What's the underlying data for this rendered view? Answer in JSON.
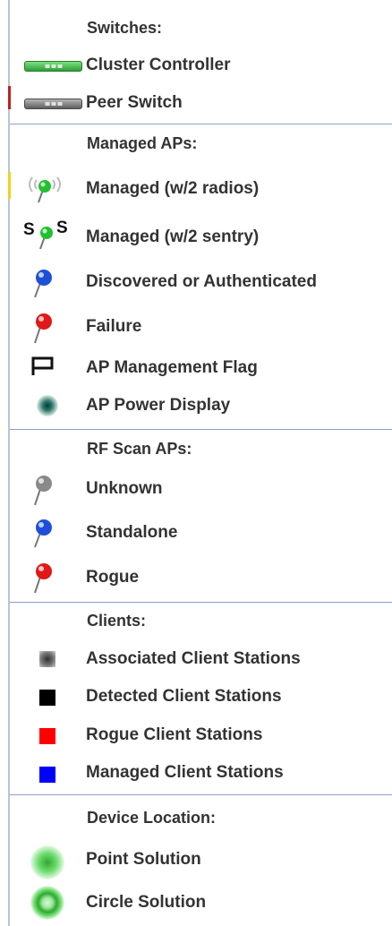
{
  "colors": {
    "divider": "#8aa0c8",
    "text": "#333333",
    "cluster_controller": "#3fb84a",
    "peer_switch": "#777777",
    "pin_green": "#22c030",
    "pin_blue": "#1f4fd8",
    "pin_red": "#e01818",
    "pin_gray": "#8a8a8a",
    "detected_client": "#000000",
    "rogue_client": "#ff0000",
    "managed_client": "#0000ff",
    "location_green": "#5ad05a"
  },
  "sections": {
    "switches": {
      "heading": "Switches:",
      "items": [
        {
          "label": "Cluster Controller",
          "icon": "green-switch-icon"
        },
        {
          "label": "Peer Switch",
          "icon": "gray-switch-icon"
        }
      ]
    },
    "managed_aps": {
      "heading": "Managed APs:",
      "items": [
        {
          "label": "Managed (w/2 radios)",
          "icon": "green-radio-pin-icon"
        },
        {
          "label": "Managed (w/2 sentry)",
          "icon": "green-sentry-pin-icon",
          "sentry_text": "S"
        },
        {
          "label": "Discovered or Authenticated",
          "icon": "blue-pin-icon"
        },
        {
          "label": "Failure",
          "icon": "red-pin-icon"
        },
        {
          "label": "AP Management Flag",
          "icon": "flag-icon"
        },
        {
          "label": "AP Power Display",
          "icon": "power-dot-icon"
        }
      ]
    },
    "rf_scan_aps": {
      "heading": "RF Scan APs:",
      "items": [
        {
          "label": "Unknown",
          "icon": "gray-pin-icon"
        },
        {
          "label": "Standalone",
          "icon": "blue-pin-icon"
        },
        {
          "label": "Rogue",
          "icon": "red-pin-icon"
        }
      ]
    },
    "clients": {
      "heading": "Clients:",
      "items": [
        {
          "label": "Associated Client Stations",
          "icon": "gradient-square-icon"
        },
        {
          "label": "Detected Client Stations",
          "icon": "black-square-icon"
        },
        {
          "label": "Rogue Client Stations",
          "icon": "red-square-icon"
        },
        {
          "label": "Managed Client Stations",
          "icon": "blue-square-icon"
        }
      ]
    },
    "device_location": {
      "heading": "Device Location:",
      "items": [
        {
          "label": "Point Solution",
          "icon": "green-point-icon"
        },
        {
          "label": "Circle Solution",
          "icon": "green-circle-icon"
        }
      ]
    }
  }
}
